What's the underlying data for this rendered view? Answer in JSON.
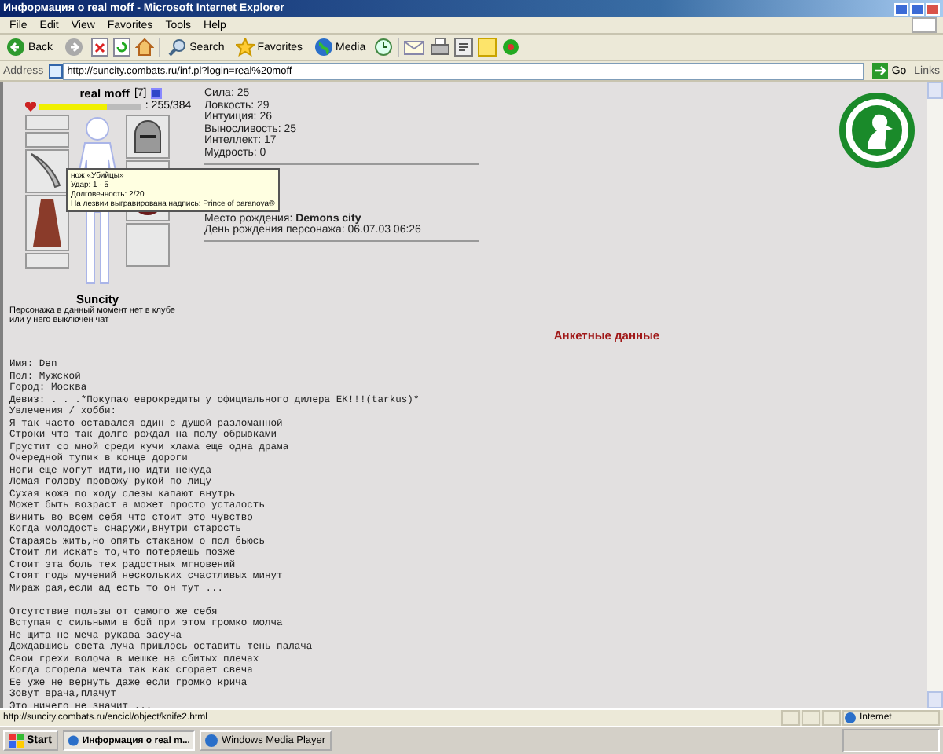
{
  "window": {
    "title": "Информация о real moff - Microsoft Internet Explorer"
  },
  "menu": [
    "File",
    "Edit",
    "View",
    "Favorites",
    "Tools",
    "Help"
  ],
  "toolbar": {
    "buttons": [
      "Back",
      "Search",
      "Favorites",
      "Media"
    ]
  },
  "address": {
    "label": "Address",
    "url": "http://suncity.combats.ru/inf.pl?login=real%20moff",
    "go": "Go",
    "links": "Links"
  },
  "character": {
    "name": "real moff",
    "rank": "[7]",
    "hp": {
      "level": 0.66,
      "reading": ": 255/384"
    },
    "stats": [
      "Сила: 25",
      "Ловкость: 29",
      "Интуиция: 26",
      "Выносливость: 25",
      "Интеллект: 17",
      "Мудрость: 0"
    ],
    "tooltip": [
      "нож «Убийцы»",
      "Удар: 1 - 5",
      "Долговечность: 2/20",
      "На лезвии выгравирована надпись: Prince of paranoya®"
    ],
    "birthplace": {
      "label": "Место рождения:",
      "value": "Demons city"
    },
    "birthday": "День рождения персонажа: 06.07.03 06:26",
    "city": "Suncity",
    "note": [
      "Персонажа в данный момент нет в клубе",
      "или у него выключен чат"
    ]
  },
  "section_title": "Анкетные данные",
  "profile": [
    "Имя: Den",
    "Пол: Мужской",
    "Город: Москва",
    "Девиз: . . .*Покупаю еврокредиты у официального дилера ЕК!!!(tarkus)*",
    "Увлечения / хобби:"
  ],
  "stanzas": [
    [
      "Я так часто оставался один с душой разломанной",
      "Строки что так долго рождал на полу обрывками",
      "Грустит со мной среди кучи хлама еще одна драма",
      "Очередной тупик в конце дороги",
      "Ноги еще могут идти,но идти некуда",
      "Ломая голову провожу рукой по лицу",
      "Сухая кожа по ходу слезы капают внутрь",
      "Может быть возраст а может просто усталость",
      "Винить во всем себя что стоит это чувство",
      "Когда молодость снаружи,внутри старость",
      "Стараясь жить,но опять стаканом о пол бьюсь",
      "Стоит ли искать то,что потеряешь позже",
      "Стоит эта боль тех радостных мгновений",
      "Стоят годы мучений нескольких счастливых минут",
      "Мираж рая,если ад есть то он тут ..."
    ],
    [
      "Отсутствие пользы от самого же себя",
      "Вступая с сильными в бой при этом громко молча",
      "Не щита не меча рукава засуча",
      "Дождавшись света луча пришлось оставить тень палача",
      "Свои грехи волоча в мешке на сбитых плечах",
      "Когда сгорела мечта так как сгорает свеча",
      "Ее уже не вернуть даже если громко крича",
      "Зовут врача,плачут",
      "Это ничего не значит ..."
    ]
  ],
  "status_bar": {
    "text": "http://suncity.combats.ru/encicl/object/knife2.html",
    "zone": "Internet"
  },
  "taskbar": {
    "start": "Start",
    "tasks": [
      {
        "label": "Информация о real m...",
        "selected": true
      },
      {
        "label": "Windows Media Player",
        "selected": false
      }
    ]
  }
}
